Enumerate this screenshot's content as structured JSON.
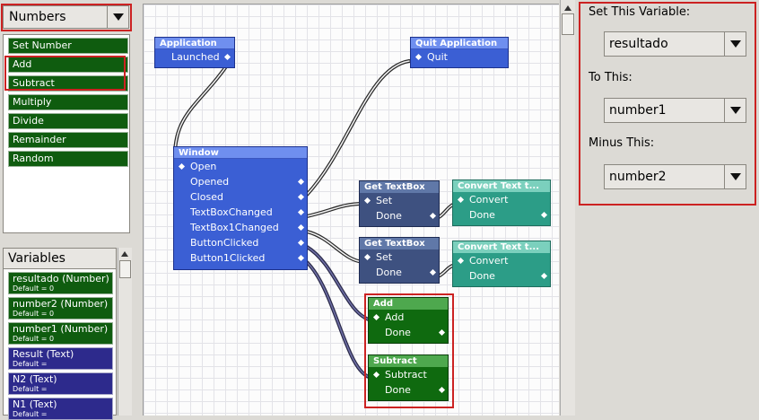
{
  "categories": {
    "selected": "Numbers"
  },
  "blocks": [
    "Set Number",
    "Add",
    "Subtract",
    "Multiply",
    "Divide",
    "Remainder",
    "Random"
  ],
  "variables": {
    "header": "Variables",
    "items": [
      {
        "name": "resultado (Number)",
        "default": "Default = 0",
        "kind": "number"
      },
      {
        "name": "number2 (Number)",
        "default": "Default = 0",
        "kind": "number"
      },
      {
        "name": "number1 (Number)",
        "default": "Default = 0",
        "kind": "number"
      },
      {
        "name": "Result (Text)",
        "default": "Default =",
        "kind": "text"
      },
      {
        "name": "N2 (Text)",
        "default": "Default =",
        "kind": "text"
      },
      {
        "name": "N1 (Text)",
        "default": "Default =",
        "kind": "text"
      }
    ]
  },
  "nodes": {
    "application": {
      "title": "Application",
      "rows": [
        "Launched"
      ]
    },
    "quit": {
      "title": "Quit Application",
      "rows": [
        "Quit"
      ]
    },
    "window": {
      "title": "Window",
      "rows": [
        "Open",
        "Opened",
        "Closed",
        "TextBoxChanged",
        "TextBox1Changed",
        "ButtonClicked",
        "Button1Clicked"
      ]
    },
    "gettext1": {
      "title": "Get TextBox",
      "rows": [
        "Set",
        "Done"
      ]
    },
    "gettext2": {
      "title": "Get TextBox",
      "rows": [
        "Set",
        "Done"
      ]
    },
    "convert1": {
      "title": "Convert Text t...",
      "rows": [
        "Convert",
        "Done"
      ]
    },
    "convert2": {
      "title": "Convert Text t...",
      "rows": [
        "Convert",
        "Done"
      ]
    },
    "add": {
      "title": "Add",
      "rows": [
        "Add",
        "Done"
      ]
    },
    "subtract": {
      "title": "Subtract",
      "rows": [
        "Subtract",
        "Done"
      ]
    }
  },
  "properties": {
    "set_label": "Set This Variable:",
    "set_value": "resultado",
    "to_label": "To This:",
    "to_value": "number1",
    "minus_label": "Minus This:",
    "minus_value": "number2"
  },
  "colors": {
    "highlight": "#cc2222",
    "number_block": "#0f5c0f",
    "text_variable": "#2d2a8c",
    "event_node": "#3b5fd4",
    "textbox_node": "#3e5180",
    "convert_node": "#2c9d87",
    "math_node": "#0f6a0f"
  }
}
